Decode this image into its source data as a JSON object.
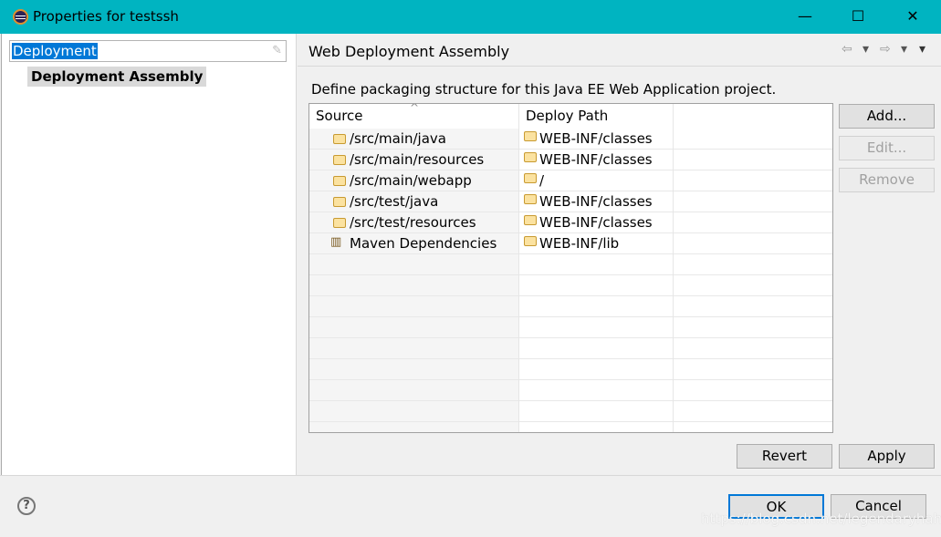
{
  "window": {
    "title": "Properties for testssh",
    "controls": {
      "minimize": "—",
      "maximize": "☐",
      "close": "✕"
    }
  },
  "filter": {
    "value": "Deployment"
  },
  "tree": {
    "items": [
      {
        "label": "Deployment Assembly",
        "selected": true
      }
    ]
  },
  "page": {
    "title": "Web Deployment Assembly",
    "description": "Define packaging structure for this Java EE Web Application project.",
    "nav": {
      "back": "⇦",
      "forward": "⇨",
      "menu": "▾"
    }
  },
  "table": {
    "columns": [
      "Source",
      "Deploy Path",
      ""
    ],
    "sort_indicator": "^",
    "rows": [
      {
        "source": "/src/main/java",
        "icon": "folder-icon",
        "path": "WEB-INF/classes"
      },
      {
        "source": "/src/main/resources",
        "icon": "folder-icon",
        "path": "WEB-INF/classes"
      },
      {
        "source": "/src/main/webapp",
        "icon": "folder-icon",
        "path": "/"
      },
      {
        "source": "/src/test/java",
        "icon": "folder-icon",
        "path": "WEB-INF/classes"
      },
      {
        "source": "/src/test/resources",
        "icon": "folder-icon",
        "path": "WEB-INF/classes"
      },
      {
        "source": "Maven Dependencies",
        "icon": "library-icon",
        "path": "WEB-INF/lib"
      }
    ]
  },
  "buttons": {
    "add": "Add...",
    "edit": "Edit...",
    "remove": "Remove",
    "revert": "Revert",
    "apply": "Apply",
    "ok": "OK",
    "cancel": "Cancel",
    "help": "?"
  },
  "watermark": "https://blog.csdn.net/legendaryhaha",
  "colors": {
    "titlebar": "#00b4c1",
    "selection": "#0078d7"
  }
}
